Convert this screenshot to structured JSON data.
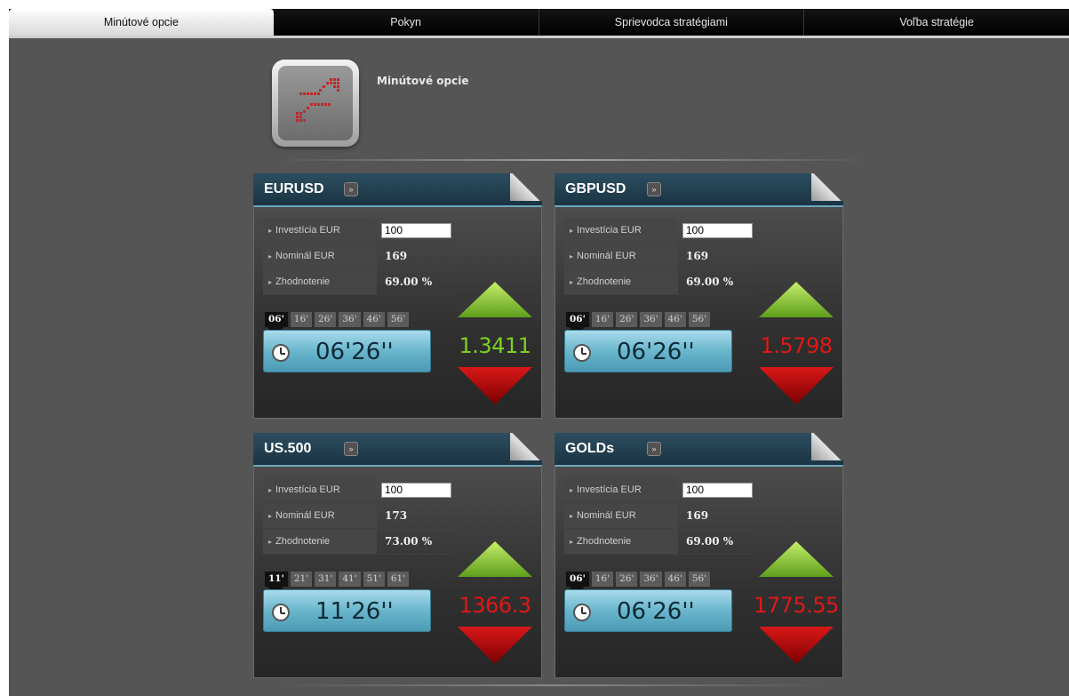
{
  "tabs": [
    {
      "label": "Minútové opcie",
      "active": true
    },
    {
      "label": "Pokyn",
      "active": false
    },
    {
      "label": "Sprievodca stratégiami",
      "active": false
    },
    {
      "label": "Voľba stratégie",
      "active": false
    }
  ],
  "app": {
    "title": "Minútové opcie",
    "icon": "chart-trend-icon",
    "icon_color": "#c0282a"
  },
  "labels": {
    "investment": "Investícia EUR",
    "nominal": "Nominál EUR",
    "yield": "Zhodnotenie"
  },
  "colors": {
    "up_price": "#7dd11e",
    "down_price": "#e01818",
    "header": "#1f3b4b",
    "timer": "#6cb8cf"
  },
  "cards": [
    {
      "symbol": "EURUSD",
      "investment": "100",
      "nominal": "169",
      "yield": "69.00 %",
      "times": [
        "06'",
        "16'",
        "26'",
        "36'",
        "46'",
        "56'"
      ],
      "timer": "06'26''",
      "price": "1.3411",
      "trend": "up"
    },
    {
      "symbol": "GBPUSD",
      "investment": "100",
      "nominal": "169",
      "yield": "69.00 %",
      "times": [
        "06'",
        "16'",
        "26'",
        "36'",
        "46'",
        "56'"
      ],
      "timer": "06'26''",
      "price": "1.5798",
      "trend": "down"
    },
    {
      "symbol": "US.500",
      "investment": "100",
      "nominal": "173",
      "yield": "73.00 %",
      "times": [
        "11'",
        "21'",
        "31'",
        "41'",
        "51'",
        "61'"
      ],
      "timer": "11'26''",
      "price": "1366.3",
      "trend": "down"
    },
    {
      "symbol": "GOLDs",
      "investment": "100",
      "nominal": "169",
      "yield": "69.00 %",
      "times": [
        "06'",
        "16'",
        "26'",
        "36'",
        "46'",
        "56'"
      ],
      "timer": "06'26''",
      "price": "1775.55",
      "trend": "down"
    }
  ]
}
